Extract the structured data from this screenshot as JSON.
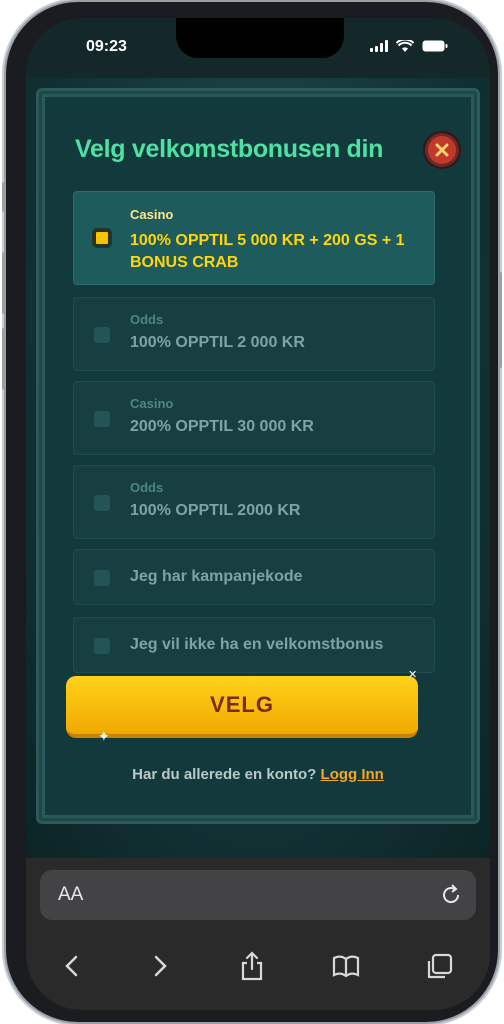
{
  "status_bar": {
    "time": "09:23"
  },
  "modal": {
    "title": "Velg velkomstbonusen din",
    "options": [
      {
        "category": "Casino",
        "label": "100% OPPTIL 5 000 KR + 200 GS + 1 BONUS CRAB",
        "selected": true
      },
      {
        "category": "Odds",
        "label": "100% OPPTIL 2 000 KR",
        "selected": false
      },
      {
        "category": "Casino",
        "label": "200% OPPTIL 30 000 KR",
        "selected": false
      },
      {
        "category": "Odds",
        "label": "100% OPPTIL 2000 KR",
        "selected": false
      },
      {
        "category": "",
        "label": "Jeg har kampanjekode",
        "selected": false
      },
      {
        "category": "",
        "label": "Jeg vil ikke ha en velkomstbonus",
        "selected": false
      }
    ],
    "cta_label": "VELG",
    "login_prompt": "Har du allerede en konto?",
    "login_link": "Logg Inn"
  },
  "browser": {
    "reader_label": "AA"
  },
  "colors": {
    "title": "#4fe0a3",
    "selected_text": "#ffd60a",
    "cta": "#f5c400",
    "link": "#f5a623"
  },
  "icons": [
    "close-icon",
    "reload-icon",
    "back-icon",
    "forward-icon",
    "share-icon",
    "bookmarks-icon",
    "tabs-icon"
  ]
}
